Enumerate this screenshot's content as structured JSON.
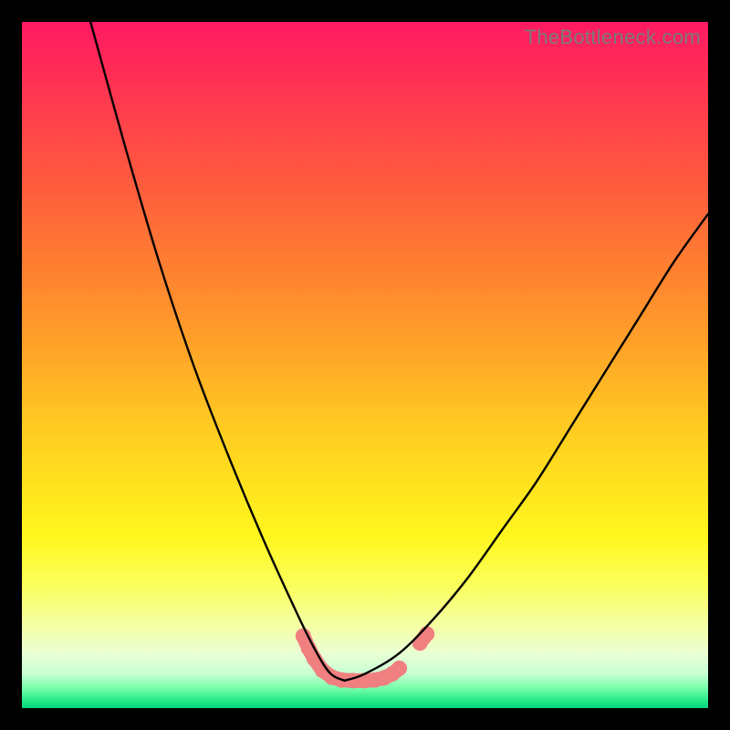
{
  "attribution": "TheBottleneck.com",
  "colors": {
    "frame": "#000000",
    "curve": "#000000",
    "marker": "#f08080",
    "gradient_stops": [
      "#ff1a62",
      "#ff2f54",
      "#ff5740",
      "#ff8030",
      "#ffa528",
      "#ffc722",
      "#ffe41e",
      "#fff61e",
      "#fbff5a",
      "#f4ffa5",
      "#eaffd4",
      "#c7ffd3",
      "#7bffad",
      "#22e887",
      "#00d47a"
    ]
  },
  "chart_data": {
    "type": "line",
    "title": "",
    "xlabel": "",
    "ylabel": "",
    "xlim": [
      0,
      100
    ],
    "ylim": [
      0,
      100
    ],
    "note": "Axes are unlabeled; values normalized 0–100 from pixel positions. y=0 is bottom (green), y=100 is top (red). Two curves form a V meeting near x≈47, y≈4.",
    "series": [
      {
        "name": "left-arm",
        "x": [
          10,
          15,
          20,
          25,
          30,
          35,
          40,
          43,
          45,
          47
        ],
        "y": [
          100,
          82,
          65,
          50,
          37,
          25,
          14,
          8,
          5,
          4
        ]
      },
      {
        "name": "right-arm",
        "x": [
          47,
          50,
          55,
          60,
          65,
          70,
          75,
          80,
          85,
          90,
          95,
          100
        ],
        "y": [
          4,
          5,
          8,
          13,
          19,
          26,
          33,
          41,
          49,
          57,
          65,
          72
        ]
      }
    ],
    "markers": {
      "name": "flat-bottom-cluster",
      "note": "Salmon rounded capsules along the trough and short segments on each arm near the bottom.",
      "points": [
        {
          "x": 41.0,
          "y": 10.5
        },
        {
          "x": 41.8,
          "y": 8.7
        },
        {
          "x": 42.6,
          "y": 7.2
        },
        {
          "x": 43.8,
          "y": 5.5
        },
        {
          "x": 45.2,
          "y": 4.5
        },
        {
          "x": 46.6,
          "y": 4.1
        },
        {
          "x": 48.2,
          "y": 4.0
        },
        {
          "x": 49.8,
          "y": 4.0
        },
        {
          "x": 51.4,
          "y": 4.1
        },
        {
          "x": 52.8,
          "y": 4.4
        },
        {
          "x": 54.0,
          "y": 5.0
        },
        {
          "x": 55.0,
          "y": 5.8
        },
        {
          "x": 58.0,
          "y": 9.5
        },
        {
          "x": 59.0,
          "y": 10.8
        }
      ]
    }
  }
}
